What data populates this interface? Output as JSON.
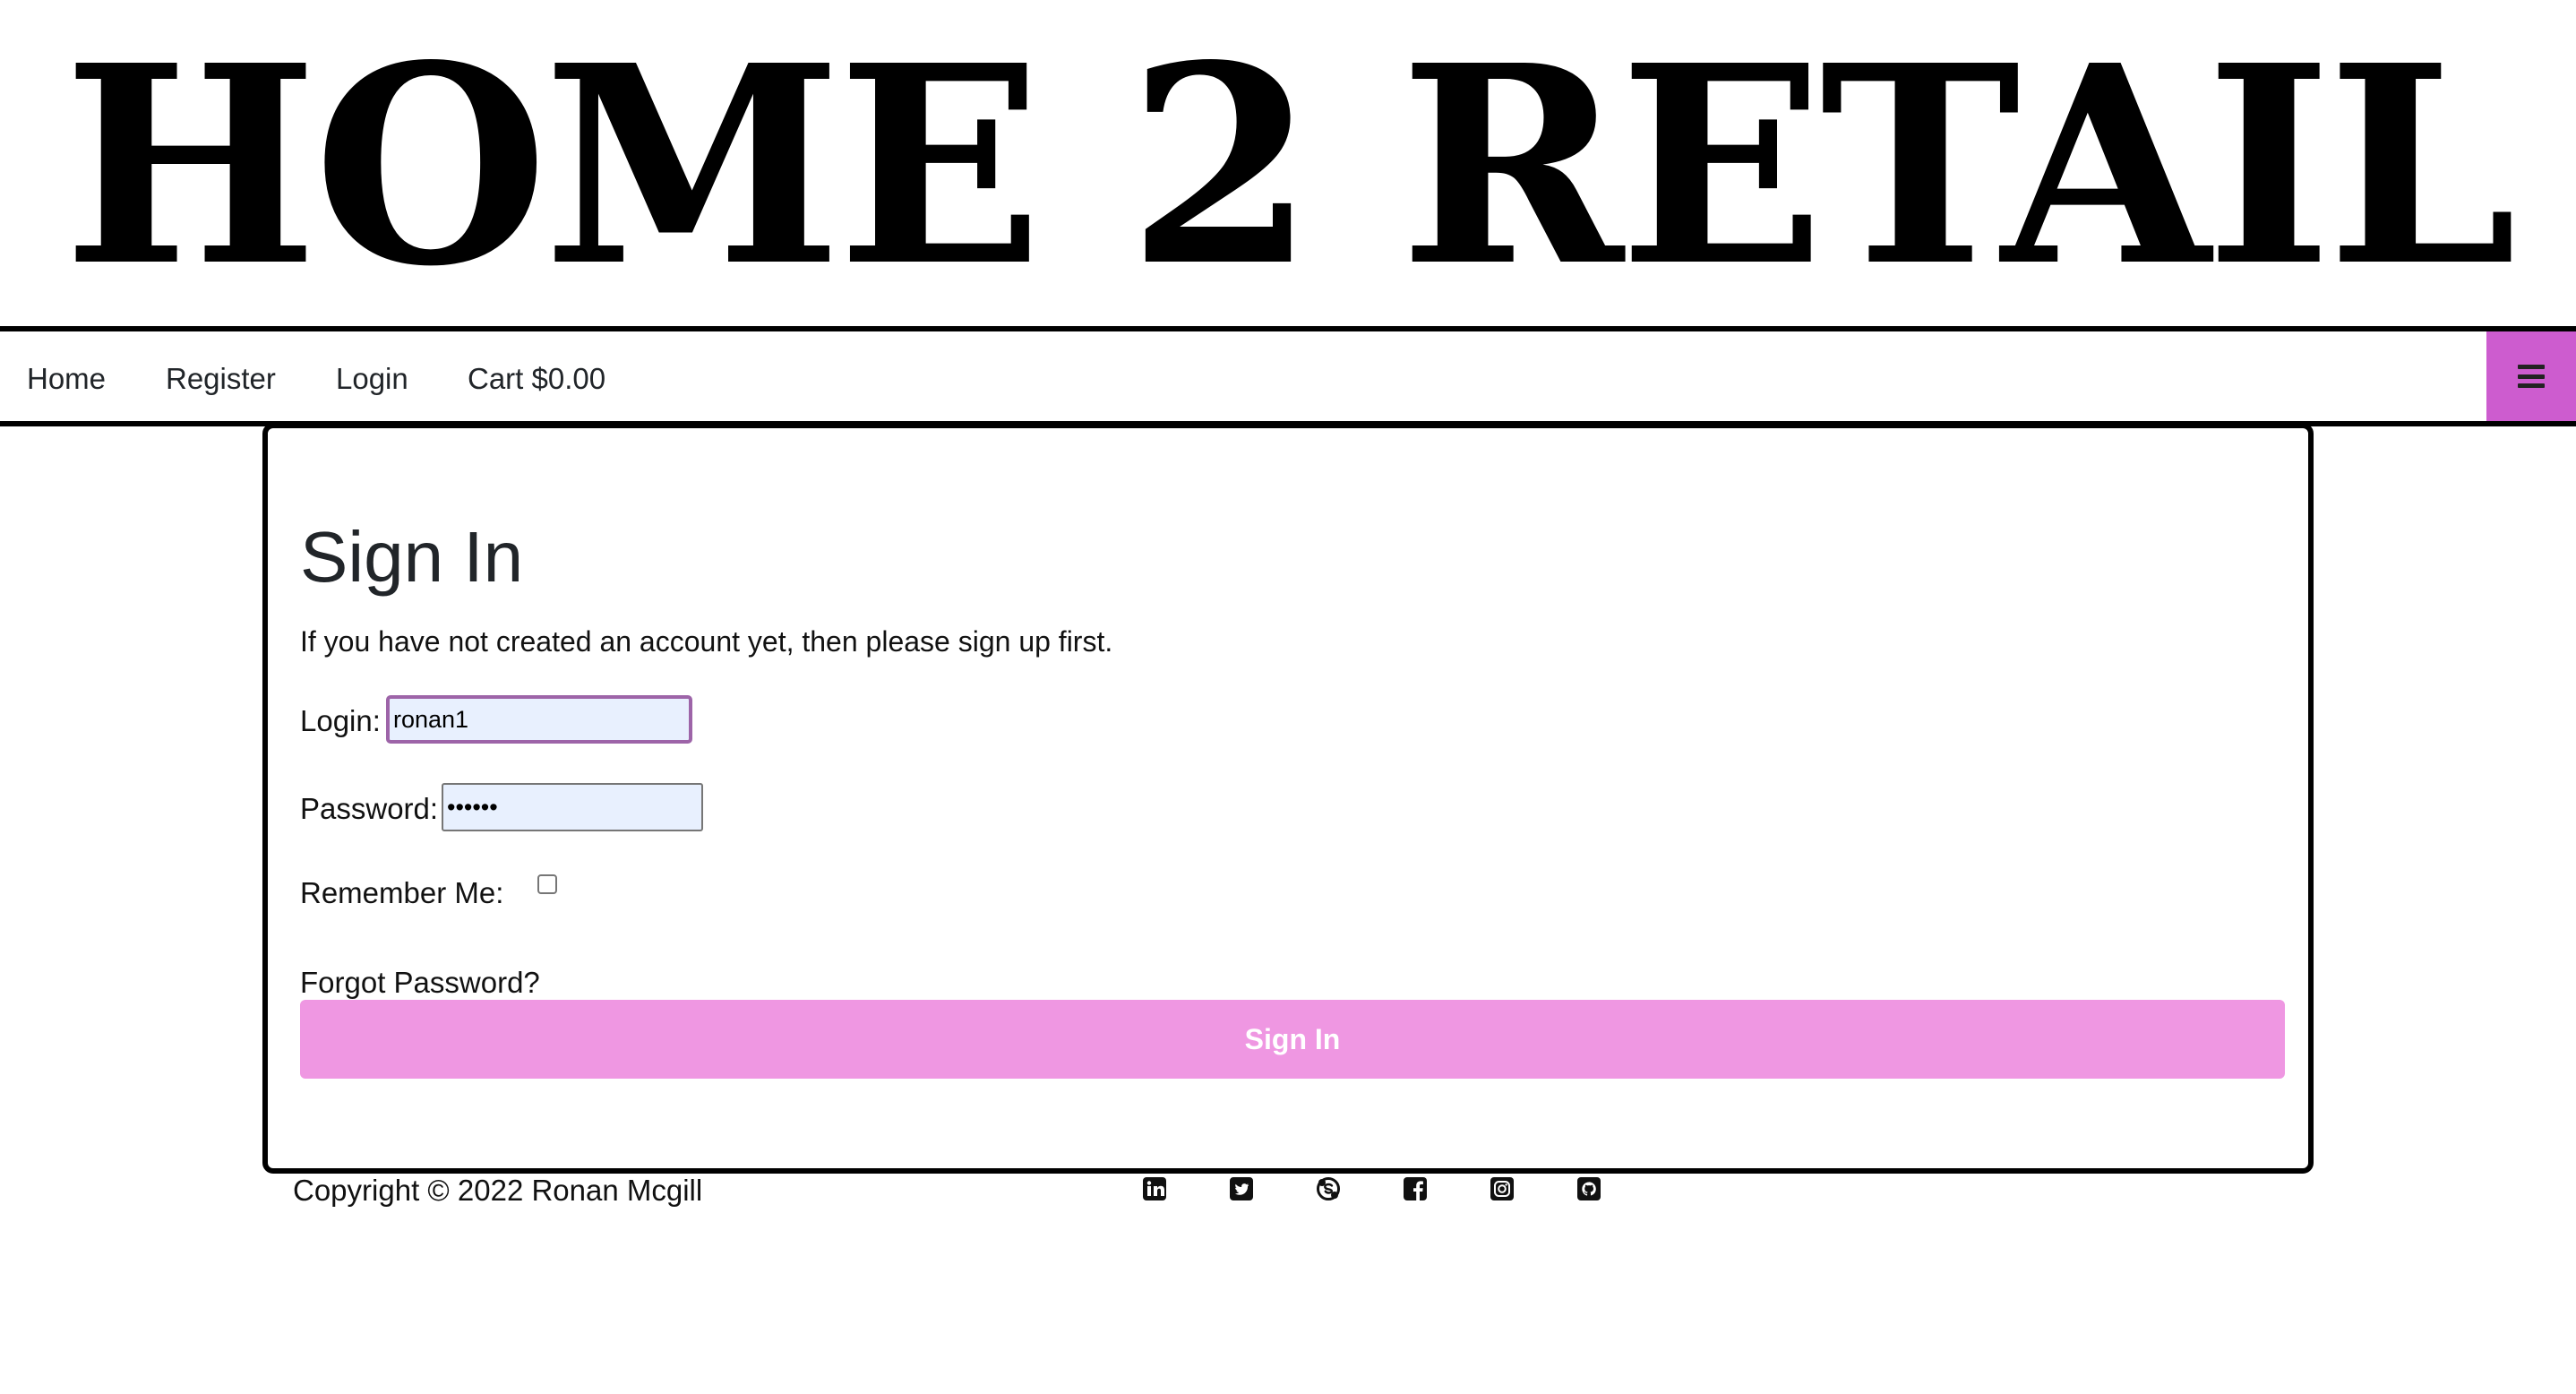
{
  "header": {
    "title": "HOME 2 RETAIL"
  },
  "nav": {
    "links": [
      {
        "label": "Home"
      },
      {
        "label": "Register"
      },
      {
        "label": "Login"
      },
      {
        "label": "Cart $0.00"
      }
    ],
    "toggle_icon": "hamburger-menu-icon",
    "accent_color": "#cd5ccf"
  },
  "signin": {
    "title": "Sign In",
    "intro": "If you have not created an account yet, then please sign up first.",
    "login_label": "Login:",
    "login_value": "ronan1",
    "password_label": "Password:",
    "password_value": "••••••",
    "remember_label": "Remember Me:",
    "remember_checked": false,
    "forgot_label": "Forgot Password?",
    "button_label": "Sign In",
    "button_color": "#ef97e2"
  },
  "footer": {
    "copyright": "Copyright © 2022 Ronan Mcgill",
    "social_icons": [
      "linkedin-icon",
      "twitter-icon",
      "skype-icon",
      "facebook-icon",
      "instagram-icon",
      "github-icon"
    ]
  }
}
